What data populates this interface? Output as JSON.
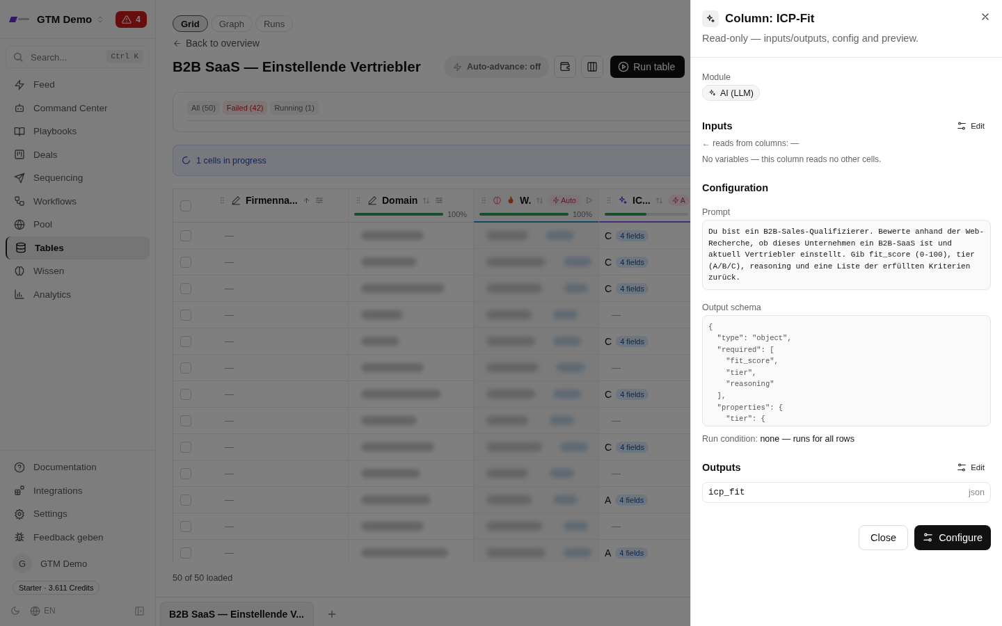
{
  "sidebar": {
    "workspace": "GTM Demo",
    "alert_count": "4",
    "search": {
      "placeholder": "Search...",
      "shortcut": "Ctrl K"
    },
    "nav": [
      {
        "label": "Feed",
        "selected": false
      },
      {
        "label": "Command Center",
        "selected": false
      },
      {
        "label": "Playbooks",
        "selected": false
      },
      {
        "label": "Deals",
        "selected": false
      },
      {
        "label": "Sequencing",
        "selected": false
      },
      {
        "label": "Workflows",
        "selected": false
      },
      {
        "label": "Pool",
        "selected": false
      },
      {
        "label": "Tables",
        "selected": true
      },
      {
        "label": "Wissen",
        "selected": false
      },
      {
        "label": "Analytics",
        "selected": false
      }
    ],
    "footer_nav": [
      {
        "label": "Documentation"
      },
      {
        "label": "Integrations"
      },
      {
        "label": "Settings"
      },
      {
        "label": "Feedback geben"
      }
    ],
    "user": {
      "initial": "G",
      "name": "GTM Demo"
    },
    "plan": "Starter · 3.611 Credits",
    "language": "EN"
  },
  "main": {
    "view_tabs": [
      {
        "label": "Grid",
        "selected": true
      },
      {
        "label": "Graph",
        "selected": false
      },
      {
        "label": "Runs",
        "selected": false
      }
    ],
    "back_link": "Back to overview",
    "title": "B2B SaaS — Einstellende Vertriebler",
    "auto_advance": "Auto-advance: off",
    "run_button": "Run table",
    "filters": [
      {
        "label": "All (50)",
        "kind": "neutral"
      },
      {
        "label": "Failed (42)",
        "kind": "error"
      },
      {
        "label": "Running (1)",
        "kind": "neutral"
      }
    ],
    "progress_banner": "1 cells in progress",
    "table": {
      "select_all": {
        "checked": false
      },
      "columns": [
        {
          "kind": "text",
          "label": "Firmenna...",
          "sorted": true
        },
        {
          "kind": "text",
          "label": "Domain",
          "sorted": false,
          "level": 1,
          "reading": "100%"
        },
        {
          "kind": "enrich",
          "label": "W.",
          "sorted": false,
          "badge": "Auto",
          "level": 1,
          "reading": "100%"
        },
        {
          "kind": "ai",
          "label": "IC...",
          "sorted": false,
          "badge": "A",
          "level": 0.5
        }
      ],
      "rows": [
        {
          "checked": false,
          "firmenname": "—",
          "tier": "C",
          "fields": "4 fields"
        },
        {
          "checked": false,
          "firmenname": "—",
          "tier": "C",
          "fields": "4 fields"
        },
        {
          "checked": false,
          "firmenname": "—",
          "tier": "C",
          "fields": "4 fields"
        },
        {
          "checked": false,
          "firmenname": "—",
          "tier": "—"
        },
        {
          "checked": false,
          "firmenname": "—",
          "tier": "C",
          "fields": "4 fields"
        },
        {
          "checked": false,
          "firmenname": "—",
          "tier": "—"
        },
        {
          "checked": false,
          "firmenname": "—",
          "tier": "C",
          "fields": "4 fields"
        },
        {
          "checked": false,
          "firmenname": "—",
          "tier": "—"
        },
        {
          "checked": false,
          "firmenname": "—",
          "tier": "C",
          "fields": "4 fields"
        },
        {
          "checked": false,
          "firmenname": "—",
          "tier": "—"
        },
        {
          "checked": false,
          "firmenname": "—",
          "tier": "A",
          "fields": "4 fields"
        },
        {
          "checked": false,
          "firmenname": "—",
          "tier": "—"
        },
        {
          "checked": false,
          "firmenname": "—",
          "tier": "A",
          "fields": "4 fields"
        }
      ]
    },
    "loaded": "50 of 50 loaded",
    "sheet_tabs": [
      {
        "label": "B2B SaaS — Einstellende V...",
        "selected": true
      }
    ]
  },
  "panel": {
    "title": "Column: ICP-Fit",
    "subtitle": "Read-only — inputs/outputs, config and preview.",
    "module_label": "Module",
    "module": "AI (LLM)",
    "inputs": {
      "heading": "Inputs",
      "edit": "Edit",
      "reads_from": "← reads from columns: —",
      "note": "No variables — this column reads no other cells."
    },
    "configuration": {
      "heading": "Configuration",
      "prompt_label": "Prompt",
      "prompt": "Du bist ein B2B-Sales-Qualifizierer. Bewerte anhand der Web-Recherche, ob dieses Unternehmen ein B2B-SaaS ist und aktuell Vertriebler einstellt. Gib fit_score (0-100), tier (A/B/C), reasoning und eine Liste der erfüllten Kriterien zurück.",
      "schema_label": "Output schema",
      "schema": "{\n  \"type\": \"object\",\n  \"required\": [\n    \"fit_score\",\n    \"tier\",\n    \"reasoning\"\n  ],\n  \"properties\": {\n    \"tier\": {",
      "run_condition_label": "Run condition:",
      "run_condition": "none — runs for all rows"
    },
    "outputs": {
      "heading": "Outputs",
      "edit": "Edit",
      "items": [
        {
          "name": "icp_fit",
          "type": "json"
        }
      ]
    },
    "buttons": [
      {
        "label": "Close",
        "kind": "secondary"
      },
      {
        "label": "Configure",
        "kind": "primary"
      }
    ]
  }
}
